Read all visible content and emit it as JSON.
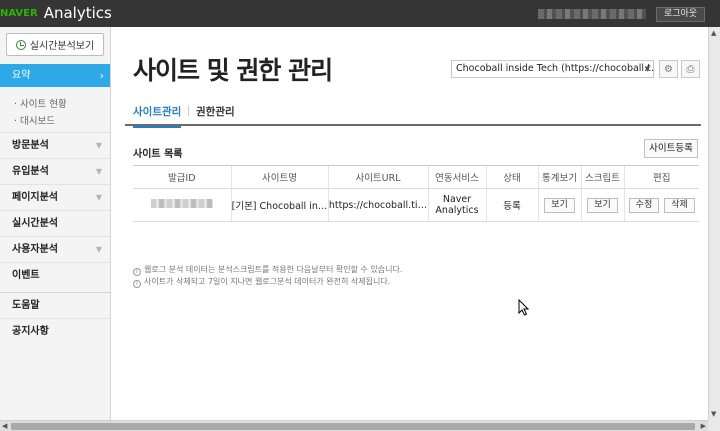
{
  "header": {
    "brand_naver": "NAVER",
    "brand_analytics": "Analytics",
    "logout_label": "로그아웃"
  },
  "sidebar": {
    "realtime_button": "실시간분석보기",
    "active_item": "요약",
    "sub_items": [
      "· 사이트 현황",
      "· 대시보드"
    ],
    "items": [
      {
        "label": "방문분석",
        "has_chevron": true
      },
      {
        "label": "유입분석",
        "has_chevron": true
      },
      {
        "label": "페이지분석",
        "has_chevron": true
      },
      {
        "label": "실시간분석",
        "has_chevron": false
      },
      {
        "label": "사용자분석",
        "has_chevron": true
      },
      {
        "label": "이벤트",
        "has_chevron": false
      },
      {
        "label": "도움말",
        "has_chevron": false
      },
      {
        "label": "공지사항",
        "has_chevron": false
      }
    ]
  },
  "main": {
    "title": "사이트 및 권한 관리",
    "site_select_value": "Chocoball inside Tech (https://chocoball.t…",
    "tabs": [
      {
        "label": "사이트관리",
        "active": true
      },
      {
        "label": "권한관리",
        "active": false
      }
    ],
    "section_title": "사이트 목록",
    "register_button": "사이트등록",
    "table": {
      "headers": [
        "발급ID",
        "사이트명",
        "사이트URL",
        "연동서비스",
        "상태",
        "통계보기",
        "스크립트",
        "편집"
      ],
      "rows": [
        {
          "site_name": "[기본] Chocoball in…",
          "site_url": "https://chocoball.ti…",
          "service_line1": "Naver",
          "service_line2": "Analytics",
          "status": "등록",
          "stats_button": "보기",
          "script_button": "보기",
          "edit_button": "수정",
          "delete_button": "삭제"
        }
      ]
    },
    "notes": [
      "웹로그 분석 데이터는 분석스크립트를 적용한 다음날부터 확인할 수 있습니다.",
      "사이트가 삭제되고 7일이 지나면 웹로그분석 데이터가 완전히 삭제됩니다."
    ]
  },
  "colors": {
    "topbar": "#353535",
    "accent": "#2ea8e6",
    "naver_green": "#2db400",
    "tab_active": "#1f7fc1"
  }
}
